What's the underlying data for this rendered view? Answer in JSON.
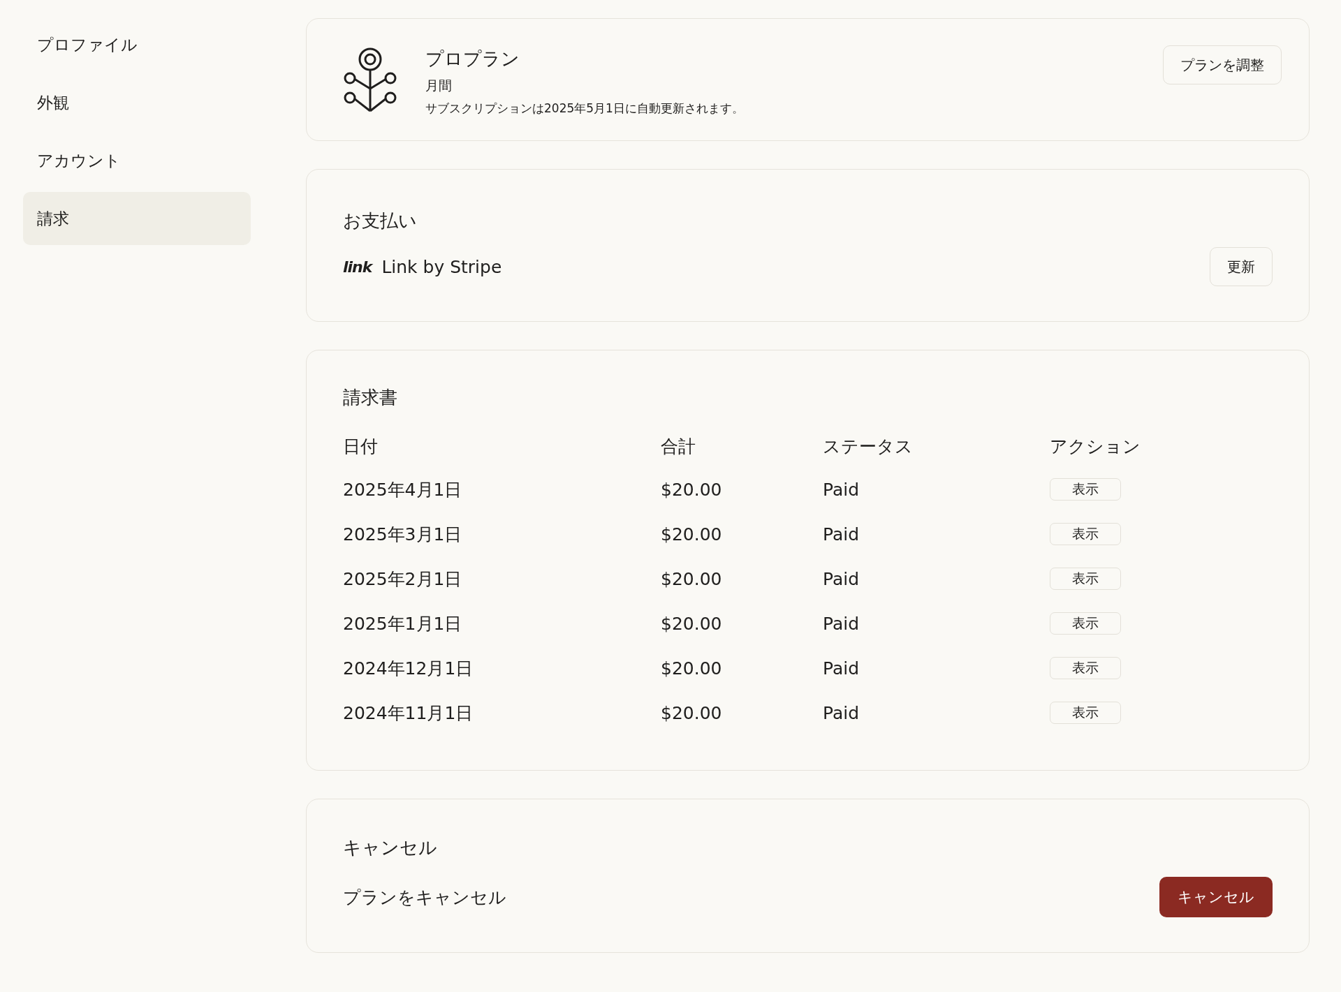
{
  "sidebar": {
    "items": [
      {
        "label": "プロファイル",
        "selected": false
      },
      {
        "label": "外観",
        "selected": false
      },
      {
        "label": "アカウント",
        "selected": false
      },
      {
        "label": "請求",
        "selected": true
      }
    ]
  },
  "plan": {
    "name": "プロプラン",
    "cycle": "月間",
    "renewal": "サブスクリプションは2025年5月1日に自動更新されます。",
    "button": "プランを調整"
  },
  "payment": {
    "title": "お支払い",
    "logo": "link",
    "method": "Link by Stripe",
    "button": "更新"
  },
  "invoices": {
    "title": "請求書",
    "columns": [
      "日付",
      "合計",
      "ステータス",
      "アクション"
    ],
    "rows": [
      {
        "date": "2025年4月1日",
        "total": "$20.00",
        "status": "Paid",
        "action": "表示"
      },
      {
        "date": "2025年3月1日",
        "total": "$20.00",
        "status": "Paid",
        "action": "表示"
      },
      {
        "date": "2025年2月1日",
        "total": "$20.00",
        "status": "Paid",
        "action": "表示"
      },
      {
        "date": "2025年1月1日",
        "total": "$20.00",
        "status": "Paid",
        "action": "表示"
      },
      {
        "date": "2024年12月1日",
        "total": "$20.00",
        "status": "Paid",
        "action": "表示"
      },
      {
        "date": "2024年11月1日",
        "total": "$20.00",
        "status": "Paid",
        "action": "表示"
      }
    ]
  },
  "cancel": {
    "title": "キャンセル",
    "label": "プランをキャンセル",
    "button": "キャンセル"
  }
}
